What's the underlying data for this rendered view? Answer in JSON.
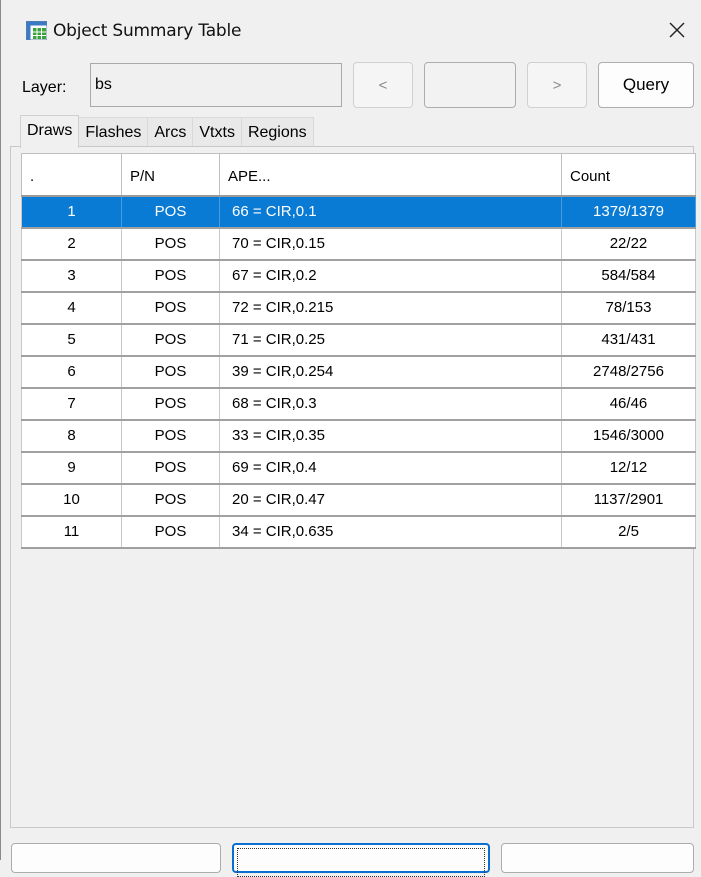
{
  "window": {
    "title": "Object Summary Table",
    "icon": "table-app-icon",
    "close_icon": "close-icon"
  },
  "toolbar": {
    "layer_label": "Layer:",
    "layer_value": "bs",
    "prev_label": "<",
    "next_label": ">",
    "page_value": "",
    "query_label": "Query"
  },
  "tabs": [
    {
      "label": "Draws",
      "active": true
    },
    {
      "label": "Flashes",
      "active": false
    },
    {
      "label": "Arcs",
      "active": false
    },
    {
      "label": "Vtxts",
      "active": false
    },
    {
      "label": "Regions",
      "active": false
    }
  ],
  "table": {
    "columns": [
      ".",
      "P/N",
      "APE...",
      "Count"
    ],
    "rows": [
      {
        "idx": "1",
        "pn": "POS",
        "ape": "66 = CIR,0.1",
        "count": "1379/1379",
        "selected": true
      },
      {
        "idx": "2",
        "pn": "POS",
        "ape": "70 = CIR,0.15",
        "count": "22/22",
        "selected": false
      },
      {
        "idx": "3",
        "pn": "POS",
        "ape": "67 = CIR,0.2",
        "count": "584/584",
        "selected": false
      },
      {
        "idx": "4",
        "pn": "POS",
        "ape": "72 = CIR,0.215",
        "count": "78/153",
        "selected": false
      },
      {
        "idx": "5",
        "pn": "POS",
        "ape": "71 = CIR,0.25",
        "count": "431/431",
        "selected": false
      },
      {
        "idx": "6",
        "pn": "POS",
        "ape": "39 = CIR,0.254",
        "count": "2748/2756",
        "selected": false
      },
      {
        "idx": "7",
        "pn": "POS",
        "ape": "68 = CIR,0.3",
        "count": "46/46",
        "selected": false
      },
      {
        "idx": "8",
        "pn": "POS",
        "ape": "33 = CIR,0.35",
        "count": "1546/3000",
        "selected": false
      },
      {
        "idx": "9",
        "pn": "POS",
        "ape": "69 = CIR,0.4",
        "count": "12/12",
        "selected": false
      },
      {
        "idx": "10",
        "pn": "POS",
        "ape": "20 = CIR,0.47",
        "count": "1137/2901",
        "selected": false
      },
      {
        "idx": "11",
        "pn": "POS",
        "ape": "34 = CIR,0.635",
        "count": "2/5",
        "selected": false
      }
    ]
  },
  "colors": {
    "selection": "#0a7bd4",
    "window_bg": "#f0f0f0",
    "focus_border": "#0a6fd0"
  }
}
